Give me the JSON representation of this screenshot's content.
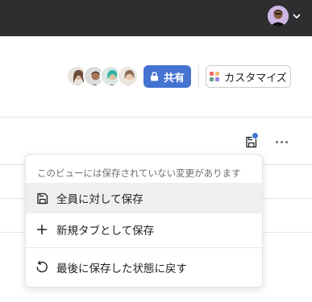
{
  "topbar": {
    "user_avatar_icon": "user-avatar",
    "dropdown_icon": "chevron-down-icon"
  },
  "header": {
    "members": [
      "member-1",
      "member-2",
      "member-3",
      "member-4"
    ],
    "share_label": "共有",
    "share_icon": "lock-icon",
    "customize_label": "カスタマイズ",
    "customize_icon": "colored-grid-icon",
    "colors": {
      "accent": "#4573d2",
      "topbar": "#2e2e30"
    }
  },
  "toolbar": {
    "save_view_icon": "save-icon",
    "unsaved_badge": "unsaved-dot",
    "more_icon": "more-horizontal-icon"
  },
  "save_menu": {
    "note": "このビューには保存されていない変更があります",
    "items": [
      {
        "label": "全員に対して保存",
        "icon": "save-icon"
      },
      {
        "label": "新規タブとして保存",
        "icon": "plus-icon"
      },
      {
        "label": "最後に保存した状態に戻す",
        "icon": "revert-icon"
      }
    ]
  }
}
